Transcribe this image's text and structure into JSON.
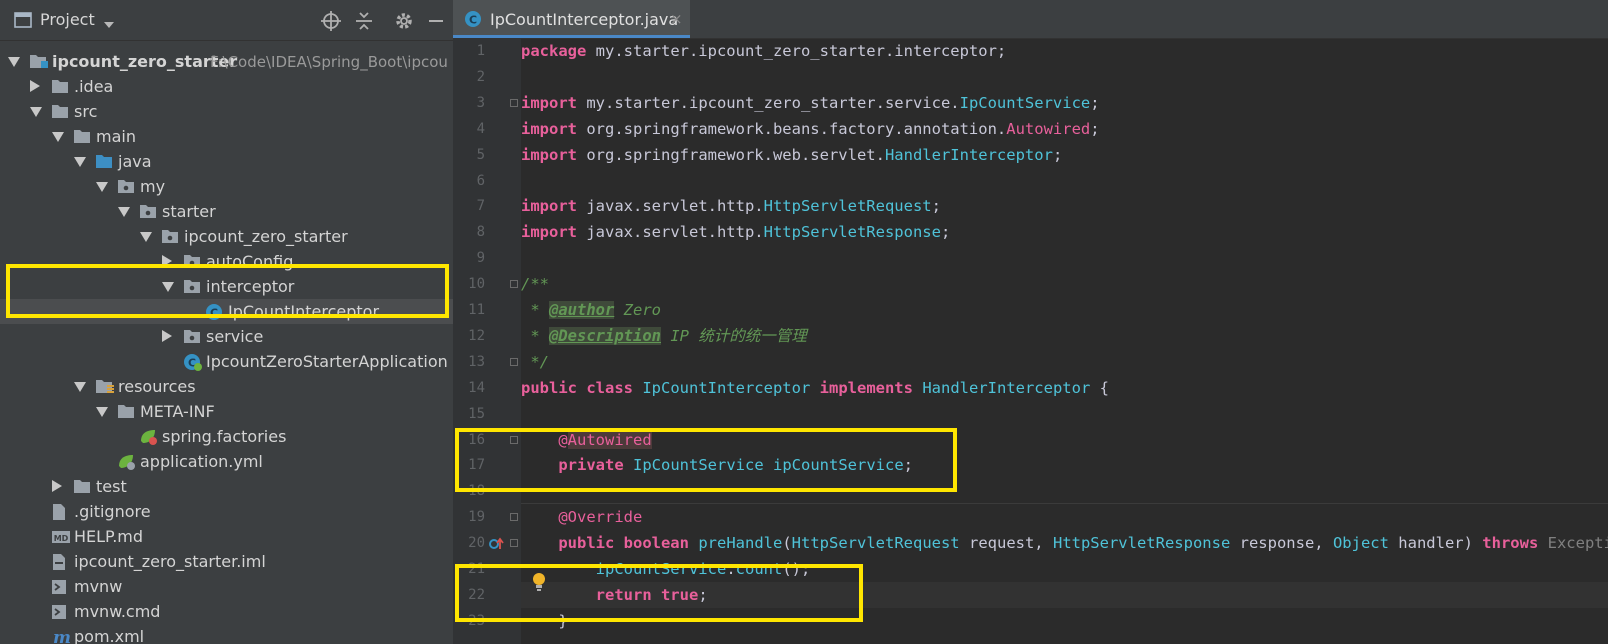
{
  "project_panel": {
    "title": "Project",
    "tree": [
      {
        "label": "ipcount_zero_starter",
        "path": "F:\\Code\\IDEA\\Spring_Boot\\ipcou",
        "bold": true,
        "level": 0,
        "arrow": "down",
        "icon": "module-folder-icon"
      },
      {
        "label": ".idea",
        "level": 1,
        "arrow": "right",
        "icon": "folder-icon"
      },
      {
        "label": "src",
        "level": 1,
        "arrow": "down",
        "icon": "folder-icon"
      },
      {
        "label": "main",
        "level": 2,
        "arrow": "down",
        "icon": "folder-icon"
      },
      {
        "label": "java",
        "level": 3,
        "arrow": "down",
        "icon": "source-folder-icon"
      },
      {
        "label": "my",
        "level": 4,
        "arrow": "down",
        "icon": "package-icon"
      },
      {
        "label": "starter",
        "level": 5,
        "arrow": "down",
        "icon": "package-icon"
      },
      {
        "label": "ipcount_zero_starter",
        "level": 6,
        "arrow": "down",
        "icon": "package-icon"
      },
      {
        "label": "autoConfig",
        "level": 7,
        "arrow": "right",
        "icon": "package-icon"
      },
      {
        "label": "interceptor",
        "level": 7,
        "arrow": "down",
        "icon": "package-icon"
      },
      {
        "label": "IpCountInterceptor",
        "level": 8,
        "arrow": "none",
        "icon": "java-class-icon",
        "selected": true
      },
      {
        "label": "service",
        "level": 7,
        "arrow": "right",
        "icon": "package-icon"
      },
      {
        "label": "IpcountZeroStarterApplication",
        "level": 7,
        "arrow": "none",
        "icon": "spring-boot-class-icon"
      },
      {
        "label": "resources",
        "level": 3,
        "arrow": "down",
        "icon": "resources-folder-icon"
      },
      {
        "label": "META-INF",
        "level": 4,
        "arrow": "down",
        "icon": "folder-icon"
      },
      {
        "label": "spring.factories",
        "level": 5,
        "arrow": "none",
        "icon": "spring-factories-icon"
      },
      {
        "label": "application.yml",
        "level": 4,
        "arrow": "none",
        "icon": "spring-yml-icon"
      },
      {
        "label": "test",
        "level": 2,
        "arrow": "right",
        "icon": "folder-icon"
      },
      {
        "label": ".gitignore",
        "level": 1,
        "arrow": "none",
        "icon": "text-file-icon"
      },
      {
        "label": "HELP.md",
        "level": 1,
        "arrow": "none",
        "icon": "markdown-file-icon"
      },
      {
        "label": "ipcount_zero_starter.iml",
        "level": 1,
        "arrow": "none",
        "icon": "iml-file-icon"
      },
      {
        "label": "mvnw",
        "level": 1,
        "arrow": "none",
        "icon": "shell-file-icon"
      },
      {
        "label": "mvnw.cmd",
        "level": 1,
        "arrow": "none",
        "icon": "cmd-file-icon"
      },
      {
        "label": "pom.xml",
        "level": 1,
        "arrow": "none",
        "icon": "maven-pom-icon"
      }
    ]
  },
  "editor": {
    "tab": {
      "label": "IpCountInterceptor.java",
      "close": "×"
    },
    "lines": [
      {
        "num": "1",
        "segs": [
          [
            "kw",
            "package"
          ],
          [
            "plain",
            " my.starter.ipcount_zero_starter.interceptor;"
          ]
        ]
      },
      {
        "num": "2",
        "segs": []
      },
      {
        "num": "3",
        "segs": [
          [
            "kw",
            "import"
          ],
          [
            "plain",
            " my.starter.ipcount_zero_starter.service."
          ],
          [
            "type",
            "IpCountService"
          ],
          [
            "plain",
            ";"
          ]
        ]
      },
      {
        "num": "4",
        "segs": [
          [
            "kw",
            "import"
          ],
          [
            "plain",
            " org.springframework.beans.factory.annotation."
          ],
          [
            "ann",
            "Autowired"
          ],
          [
            "plain",
            ";"
          ]
        ]
      },
      {
        "num": "5",
        "segs": [
          [
            "kw",
            "import"
          ],
          [
            "plain",
            " org.springframework.web.servlet."
          ],
          [
            "type",
            "HandlerInterceptor"
          ],
          [
            "plain",
            ";"
          ]
        ]
      },
      {
        "num": "6",
        "segs": []
      },
      {
        "num": "7",
        "segs": [
          [
            "kw",
            "import"
          ],
          [
            "plain",
            " javax.servlet.http."
          ],
          [
            "type",
            "HttpServletRequest"
          ],
          [
            "plain",
            ";"
          ]
        ]
      },
      {
        "num": "8",
        "segs": [
          [
            "kw",
            "import"
          ],
          [
            "plain",
            " javax.servlet.http."
          ],
          [
            "type",
            "HttpServletResponse"
          ],
          [
            "plain",
            ";"
          ]
        ]
      },
      {
        "num": "9",
        "segs": []
      },
      {
        "num": "10",
        "segs": [
          [
            "comment",
            "/**"
          ]
        ]
      },
      {
        "num": "11",
        "segs": [
          [
            "comment",
            " * "
          ],
          [
            "doc-tag",
            "@author"
          ],
          [
            "comment",
            " Zero"
          ]
        ]
      },
      {
        "num": "12",
        "segs": [
          [
            "comment",
            " * "
          ],
          [
            "doc-tag",
            "@Description"
          ],
          [
            "comment",
            " IP 统计的统一管理"
          ]
        ]
      },
      {
        "num": "13",
        "segs": [
          [
            "comment",
            " */"
          ]
        ]
      },
      {
        "num": "14",
        "segs": [
          [
            "kw",
            "public class"
          ],
          [
            "plain",
            " "
          ],
          [
            "type",
            "IpCountInterceptor"
          ],
          [
            "plain",
            " "
          ],
          [
            "kw",
            "implements"
          ],
          [
            "plain",
            " "
          ],
          [
            "type",
            "HandlerInterceptor"
          ],
          [
            "plain",
            " {"
          ]
        ]
      },
      {
        "num": "15",
        "segs": []
      },
      {
        "num": "16",
        "segs": [
          [
            "plain",
            "    "
          ],
          [
            "ann",
            "@"
          ],
          [
            "ann-hl",
            "Autowired"
          ]
        ]
      },
      {
        "num": "17",
        "segs": [
          [
            "plain",
            "    "
          ],
          [
            "kw",
            "private"
          ],
          [
            "plain",
            " "
          ],
          [
            "type",
            "IpCountService"
          ],
          [
            "plain",
            " "
          ],
          [
            "field",
            "ipCountService"
          ],
          [
            "plain",
            ";"
          ]
        ]
      },
      {
        "num": "18",
        "segs": []
      },
      {
        "num": "19",
        "segs": [
          [
            "plain",
            "    "
          ],
          [
            "ann",
            "@Override"
          ]
        ]
      },
      {
        "num": "20",
        "segs": [
          [
            "plain",
            "    "
          ],
          [
            "kw",
            "public boolean"
          ],
          [
            "plain",
            " "
          ],
          [
            "method",
            "preHandle"
          ],
          [
            "plain",
            "("
          ],
          [
            "type",
            "HttpServletRequest"
          ],
          [
            "plain",
            " request, "
          ],
          [
            "type",
            "HttpServletResponse"
          ],
          [
            "plain",
            " response, "
          ],
          [
            "type",
            "Object"
          ],
          [
            "plain",
            " handler) "
          ],
          [
            "kw",
            "throws"
          ],
          [
            "plain",
            " "
          ],
          [
            "dim",
            "Exception"
          ]
        ]
      },
      {
        "num": "21",
        "segs": [
          [
            "plain",
            "        "
          ],
          [
            "field",
            "ipCountService"
          ],
          [
            "plain",
            "."
          ],
          [
            "method",
            "count"
          ],
          [
            "plain",
            "();"
          ]
        ]
      },
      {
        "num": "22",
        "segs": [
          [
            "plain",
            "        "
          ],
          [
            "kw",
            "return true"
          ],
          [
            "plain",
            ";"
          ]
        ]
      },
      {
        "num": "23",
        "segs": [
          [
            "plain",
            "    }"
          ]
        ]
      }
    ]
  },
  "colors": {
    "highlight_box": "#ffe600",
    "panel_bg": "#3c3f41",
    "editor_bg": "#2b2b2b",
    "keyword": "#e8609b",
    "type": "#4fc3d9",
    "comment": "#629755"
  }
}
